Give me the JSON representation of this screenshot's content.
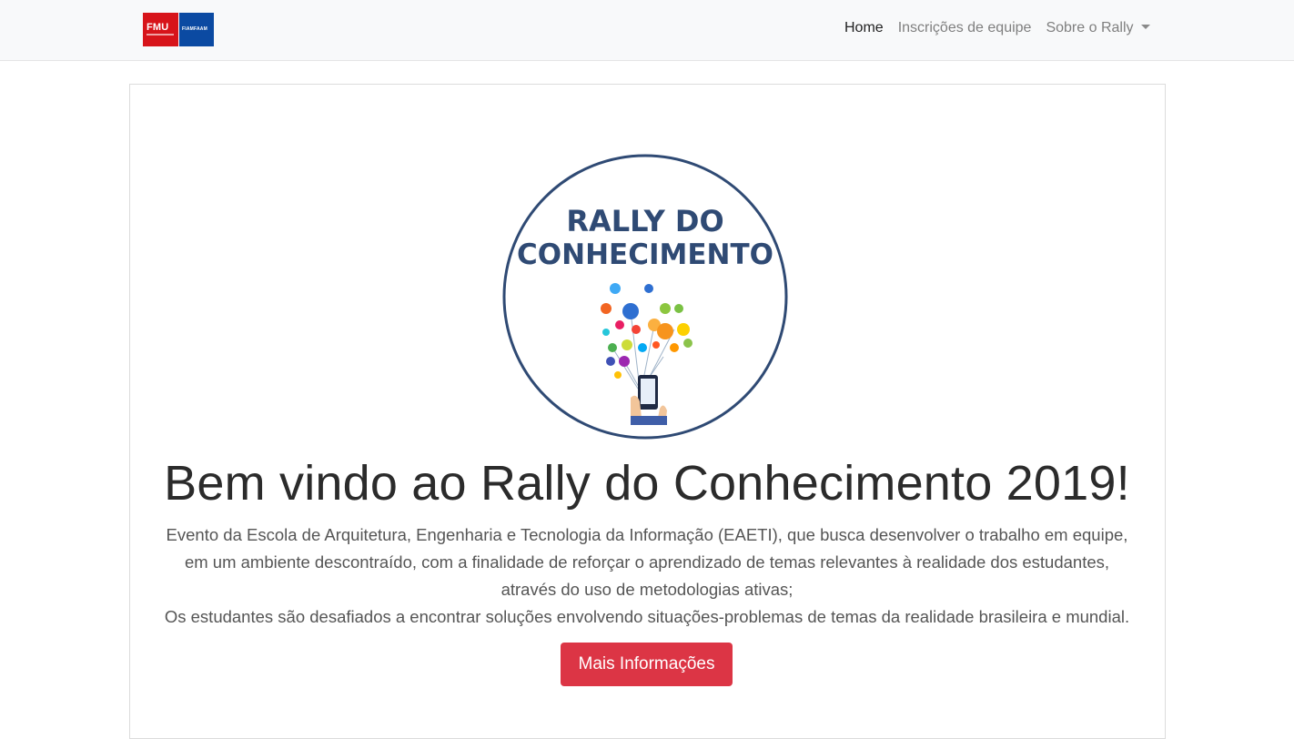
{
  "navbar": {
    "brand": {
      "left_text": "FMU",
      "right_text": "FIAMFAAM"
    },
    "items": [
      {
        "label": "Home"
      },
      {
        "label": "Inscrições de equipe"
      },
      {
        "label": "Sobre o Rally"
      }
    ]
  },
  "hero": {
    "logo": {
      "line1": "RALLY DO",
      "line2": "CONHECIMENTO"
    },
    "title": "Bem vindo ao Rally do Conhecimento 2019!",
    "lines": [
      "Evento da Escola de Arquitetura, Engenharia e Tecnologia da Informação (EAETI), que busca desenvolver o trabalho em equipe,",
      "em um ambiente descontraído, com a finalidade de reforçar o aprendizado de temas relevantes à realidade dos estudantes,",
      "através do uso de metodologias ativas;",
      "Os estudantes são desafiados a encontrar soluções envolvendo situações-problemas de temas da realidade brasileira e mundial."
    ],
    "button_label": "Mais Informações"
  },
  "colors": {
    "navbar_bg": "#f8f9fa",
    "button_bg": "#dc3545",
    "brand_red": "#d7141a",
    "brand_blue": "#0b4aa2",
    "logo_ring": "#2f4a74"
  }
}
